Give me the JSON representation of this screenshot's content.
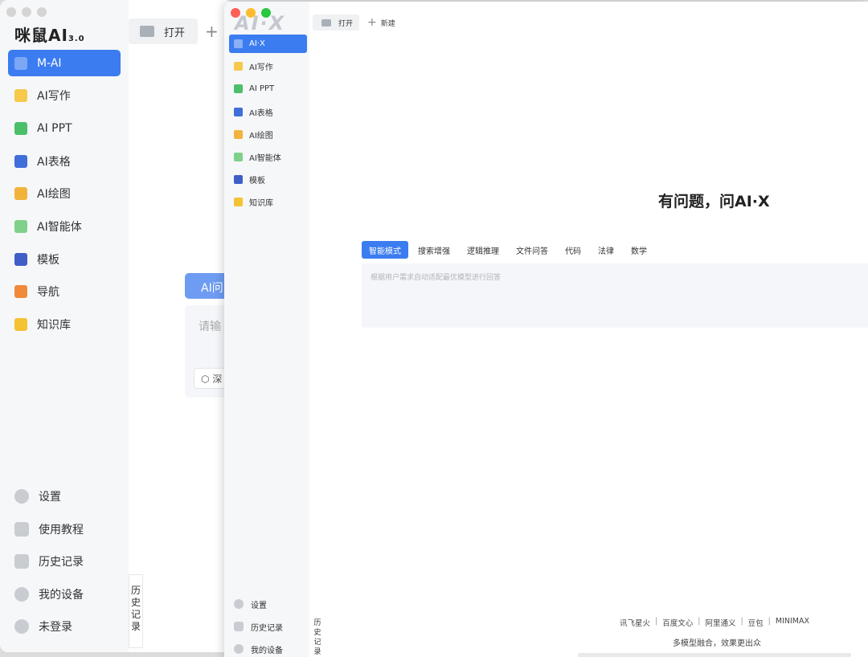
{
  "back_window": {
    "brand": "咪鼠AI",
    "brand_version": "3.0",
    "nav": [
      {
        "label": "M-AI",
        "icon": "m-ai-icon",
        "color": "#3b7cf0",
        "active": true
      },
      {
        "label": "AI写作",
        "icon": "writing-icon",
        "color": "#f6c94c",
        "active": false
      },
      {
        "label": "AI PPT",
        "icon": "ppt-icon",
        "color": "#4cbf6a",
        "active": false
      },
      {
        "label": "AI表格",
        "icon": "table-icon",
        "color": "#3f6fd9",
        "active": false
      },
      {
        "label": "AI绘图",
        "icon": "palette-icon",
        "color": "#f2b33d",
        "active": false
      },
      {
        "label": "AI智能体",
        "icon": "robot-icon",
        "color": "#7fd08a",
        "active": false
      },
      {
        "label": "模板",
        "icon": "template-icon",
        "color": "#3f5fc7",
        "active": false
      },
      {
        "label": "导航",
        "icon": "navigation-icon",
        "color": "#f08a3a",
        "active": false
      },
      {
        "label": "知识库",
        "icon": "bulb-icon",
        "color": "#f5c232",
        "active": false
      }
    ],
    "bottom": [
      {
        "label": "设置",
        "icon": "gear-icon"
      },
      {
        "label": "使用教程",
        "icon": "book-icon"
      },
      {
        "label": "历史记录",
        "icon": "history-icon"
      },
      {
        "label": "我的设备",
        "icon": "device-icon"
      },
      {
        "label": "未登录",
        "icon": "user-icon"
      }
    ],
    "tab_open": "打开",
    "ai_tab": "AI问",
    "input_placeholder": "请输",
    "deep_button": "深",
    "history_vertical": "历史记录"
  },
  "front_window": {
    "logo": "AI·X",
    "nav": [
      {
        "label": "AI·X",
        "icon": "aix-icon",
        "color": "#3b7cf0",
        "active": true
      },
      {
        "label": "AI写作",
        "icon": "writing-icon",
        "color": "#f6c94c",
        "active": false
      },
      {
        "label": "AI PPT",
        "icon": "ppt-icon",
        "color": "#4cbf6a",
        "active": false
      },
      {
        "label": "AI表格",
        "icon": "table-icon",
        "color": "#3f6fd9",
        "active": false
      },
      {
        "label": "AI绘图",
        "icon": "palette-icon",
        "color": "#f2b33d",
        "active": false
      },
      {
        "label": "AI智能体",
        "icon": "robot-icon",
        "color": "#7fd08a",
        "active": false
      },
      {
        "label": "模板",
        "icon": "template-icon",
        "color": "#3f5fc7",
        "active": false
      },
      {
        "label": "知识库",
        "icon": "bulb-icon",
        "color": "#f5c232",
        "active": false
      }
    ],
    "bottom": [
      {
        "label": "设置",
        "icon": "gear-icon"
      },
      {
        "label": "历史记录",
        "icon": "history-icon"
      },
      {
        "label": "我的设备",
        "icon": "device-icon"
      }
    ],
    "history_vertical": "历史记录",
    "tab_open": "打开",
    "new_tab": "新建",
    "hero": "有问题，问AI·X",
    "modes": [
      "智能模式",
      "搜索增强",
      "逻辑推理",
      "文件问答",
      "代码",
      "法律",
      "数学"
    ],
    "active_mode": "智能模式",
    "query_placeholder": "根据用户需求自动适配最优模型进行回答",
    "providers": [
      "讯飞星火",
      "百度文心",
      "阿里通义",
      "豆包",
      "MINIMAX"
    ],
    "tagline": "多模型融合，效果更出众"
  }
}
